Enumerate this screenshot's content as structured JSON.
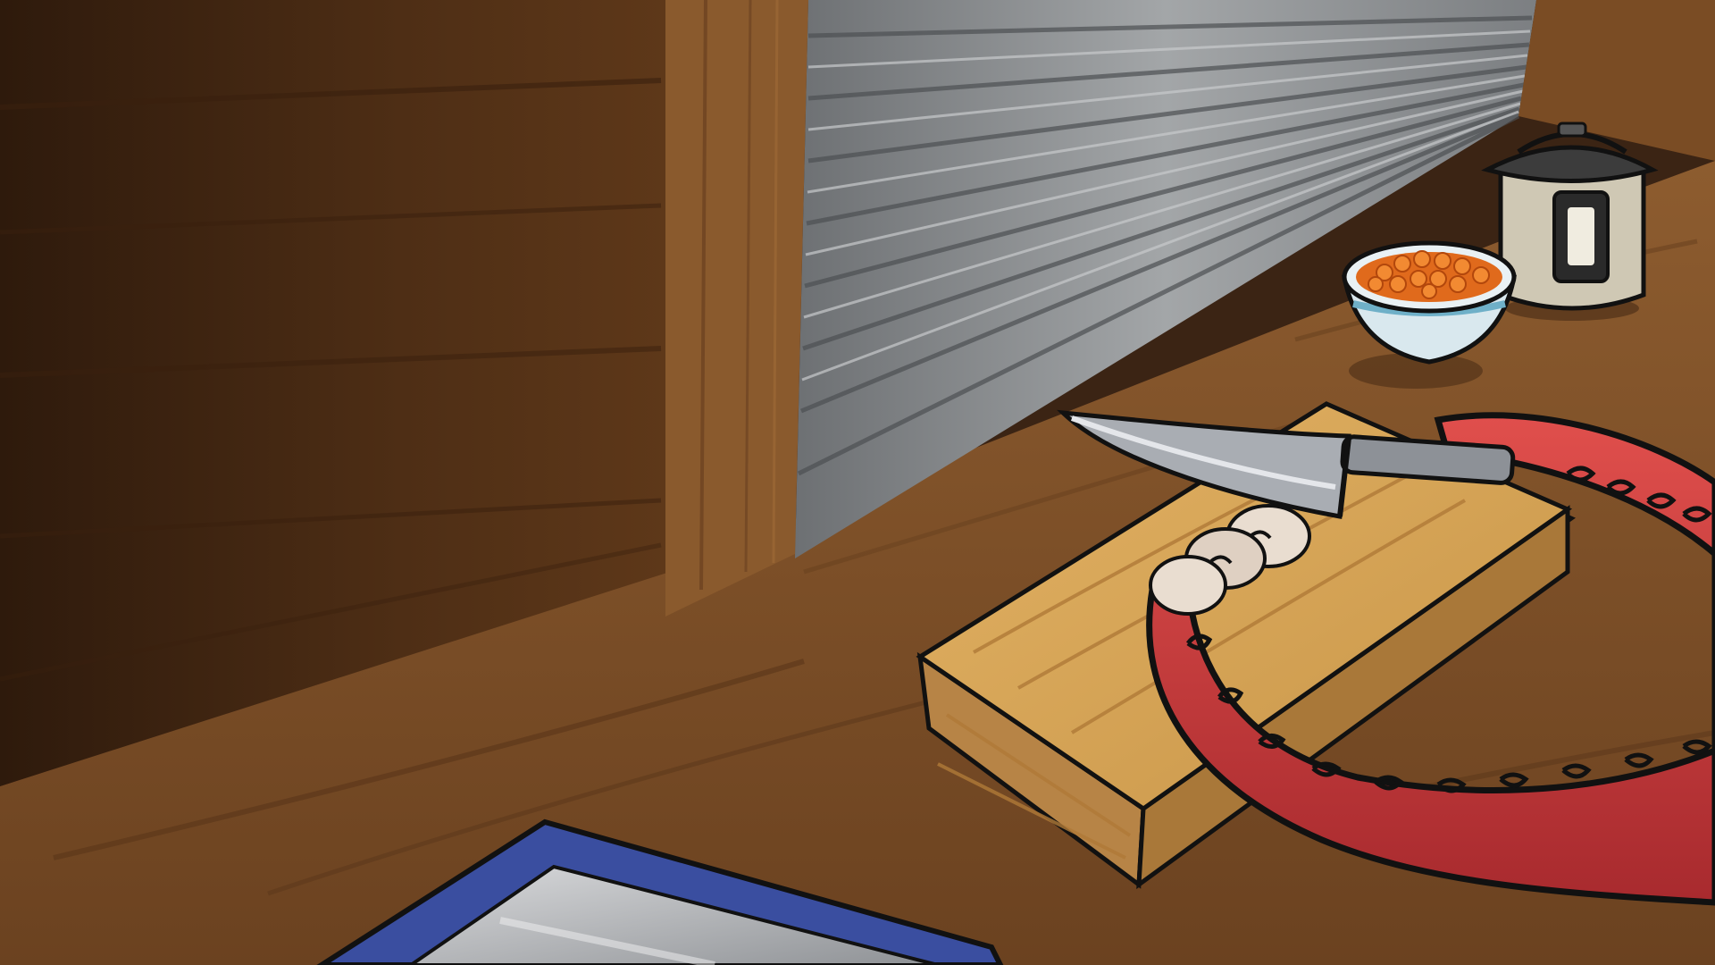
{
  "scene": {
    "description_hidden": "",
    "objects": {
      "shutter": {
        "icon": "rolling-shutter"
      },
      "pressure_cooker": {
        "icon": "pressure-cooker-icon"
      },
      "bowl": {
        "icon": "bowl-of-ikura-icon"
      },
      "cutting_board": {
        "icon": "cutting-board-icon"
      },
      "knife": {
        "icon": "knife-icon"
      },
      "octopus_tentacle": {
        "icon": "tentacle-icon"
      },
      "tablet": {
        "icon": "tablet-icon"
      }
    }
  },
  "colors": {
    "wall_dark": "#3a2010",
    "wall_mid": "#5a3518",
    "counter": "#8a5a2e",
    "shutter": "#8a8c8e",
    "board": "#d8a75a",
    "tentacle": "#c8373a",
    "tablet_frame": "#3a4ea0",
    "knife_blade": "#a9adb3"
  }
}
